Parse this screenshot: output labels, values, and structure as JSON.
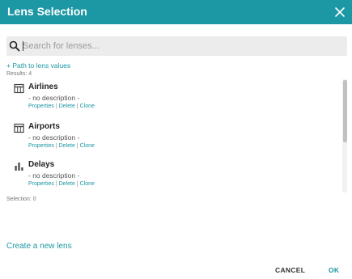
{
  "dialog": {
    "title": "Lens Selection"
  },
  "search": {
    "placeholder": "Search for lenses...",
    "value": ""
  },
  "path_link": "+ Path to lens values",
  "results_count": "Results: 4",
  "lenses": [
    {
      "name": "Airlines",
      "icon": "table-icon",
      "description": "- no description -",
      "actions": {
        "properties": "Properties",
        "sep1": " | ",
        "delete": "Delete",
        "sep2": " | ",
        "clone": "Clone"
      }
    },
    {
      "name": "Airports",
      "icon": "table-icon",
      "description": "- no description -",
      "actions": {
        "properties": "Properties",
        "sep1": " | ",
        "delete": "Delete",
        "sep2": " | ",
        "clone": "Clone"
      }
    },
    {
      "name": "Delays",
      "icon": "bar-chart-icon",
      "description": "- no description -",
      "actions": {
        "properties": "Properties",
        "sep1": " | ",
        "delete": "Delete",
        "sep2": " | ",
        "clone": "Clone"
      }
    }
  ],
  "selection_count": "Selection: 0",
  "create_link": "Create a new lens",
  "buttons": {
    "cancel": "CANCEL",
    "ok": "OK"
  },
  "colors": {
    "accent": "#1c97a4",
    "header_bg": "#1c97a4",
    "search_bg": "#ececec"
  }
}
